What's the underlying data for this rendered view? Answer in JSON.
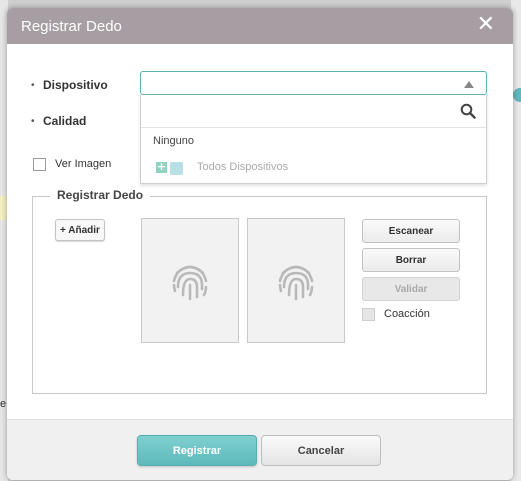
{
  "dialog": {
    "title": "Registrar Dedo",
    "close_glyph": "✕"
  },
  "form": {
    "bullet": "•",
    "dispositivo_label": "Dispositivo",
    "calidad_label": "Calidad",
    "ver_imagen_label": "Ver Imagen",
    "dispositivo_value": ""
  },
  "dropdown": {
    "search_value": "",
    "items": [
      {
        "label": "Ninguno",
        "muted": false
      },
      {
        "label": "Todos Dispositivos",
        "muted": true
      }
    ]
  },
  "register_section": {
    "legend": "Registrar Dedo",
    "add_label": "+ Añadir",
    "fingerprint_icons": [
      "fingerprint-icon",
      "fingerprint-icon"
    ],
    "actions": {
      "scan": "Escanear",
      "delete": "Borrar",
      "validate": "Validar"
    },
    "coercion_label": "Coacción"
  },
  "footer": {
    "register": "Registrar",
    "cancel": "Cancelar"
  },
  "background": {
    "edge_letter": "e"
  },
  "colors": {
    "header": "#a69ea2",
    "accent": "#62b6bd",
    "primary_button": "#6cc4c6"
  }
}
